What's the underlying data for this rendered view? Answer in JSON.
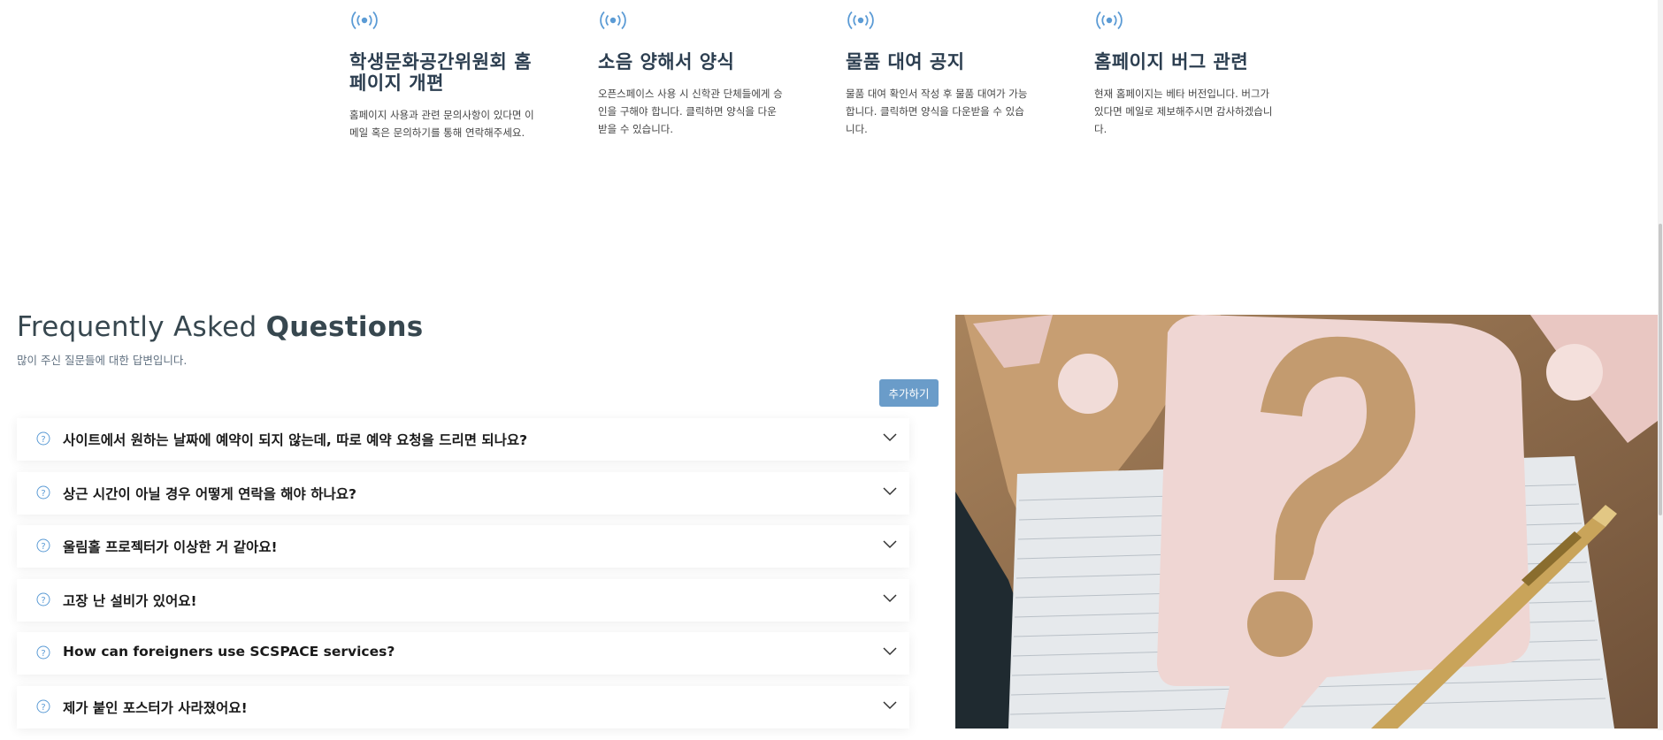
{
  "notices": [
    {
      "title": "학생문화공간위원회 홈페이지 개편",
      "body": "홈페이지 사용과 관련 문의사항이 있다면 이메일 혹은 문의하기를 통해 연락해주세요."
    },
    {
      "title": "소음 양해서 양식",
      "body": "오픈스페이스 사용 시 신학관 단체들에게 승인을 구해야 합니다. 클릭하면 양식을 다운받을 수 있습니다."
    },
    {
      "title": "물품 대여 공지",
      "body": "물품 대여 확인서 작성 후 물품 대여가 가능합니다. 클릭하면 양식을 다운받을 수 있습니다."
    },
    {
      "title": "홈페이지 버그 관련",
      "body": "현재 홈페이지는 베타 버전입니다. 버그가 있다면 메일로 제보해주시면 감사하겠습니다."
    }
  ],
  "faq": {
    "title_light": "Frequently Asked ",
    "title_bold": "Questions",
    "subtitle": "많이 주신 질문들에 대한 답변입니다.",
    "add_label": "추가하기",
    "items": [
      "사이트에서 원하는 날짜에 예약이 되지 않는데, 따로 예약 요청을 드리면 되나요?",
      "상근 시간이 아닐 경우 어떻게 연락을 해야 하나요?",
      "울림홀 프로젝터가 이상한 거 같아요!",
      "고장 난 설비가 있어요!",
      "How can foreigners use SCSPACE services?",
      "제가 붙인 포스터가 사라졌어요!"
    ]
  },
  "colors": {
    "accent": "#6a9cc9",
    "icon": "#5b9bd5",
    "heading": "#2c3e50"
  },
  "icons": {
    "notice": "broadcast-icon",
    "question": "question-circle-icon",
    "expand": "chevron-down-icon"
  }
}
